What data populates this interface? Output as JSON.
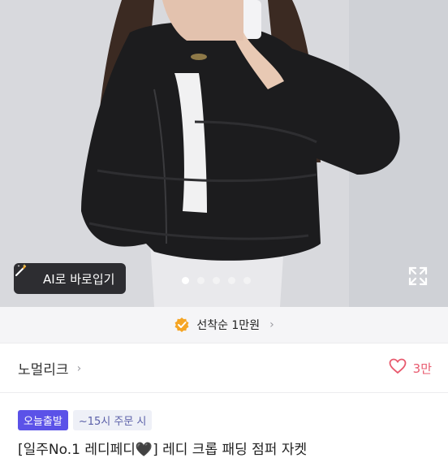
{
  "hero": {
    "ai_button_label": "AI로 바로입기",
    "ai_icon": "magic-wand-icon",
    "expand_icon": "expand-icon",
    "carousel": {
      "total": 5,
      "active_index": 0
    }
  },
  "promo": {
    "text": "선착순 1만원",
    "icon": "check-badge-icon"
  },
  "brand": {
    "name": "노멀리크",
    "like_count": "3만"
  },
  "badges": {
    "fast": "오늘출발",
    "deadline": "~15시 주문 시"
  },
  "product": {
    "title": "[일주No.1 레디페디🖤] 레디 크롭 패딩 점퍼 자켓"
  },
  "colors": {
    "accent": "#5b52e8",
    "like": "#e85a6e",
    "promo_check": "#f5a524"
  }
}
